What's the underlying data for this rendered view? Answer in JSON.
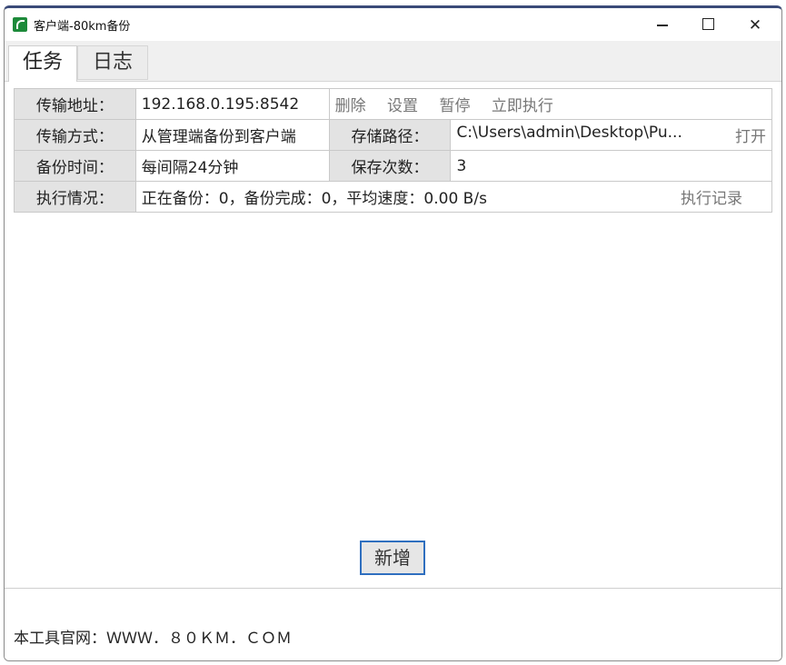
{
  "window": {
    "title": "客户端-80km备份",
    "controls": {
      "minimize": "—",
      "maximize": "□",
      "close": "✕"
    }
  },
  "tabs": [
    {
      "label": "任务",
      "active": true
    },
    {
      "label": "日志",
      "active": false
    }
  ],
  "task": {
    "address_label": "传输地址：",
    "address_value": "192.168.0.195:8542",
    "actions": {
      "delete": "删除",
      "settings": "设置",
      "pause": "暂停",
      "run_now": "立即执行"
    },
    "mode_label": "传输方式：",
    "mode_value": "从管理端备份到客户端",
    "path_label": "存储路径：",
    "path_value": "C:\\Users\\admin\\Desktop\\Pu...",
    "open_label": "打开",
    "time_label": "备份时间：",
    "time_value": "每间隔24分钟",
    "count_label": "保存次数：",
    "count_value": "3",
    "status_label": "执行情况：",
    "status_value": "正在备份：0，备份完成：0，平均速度：0.00 B/s",
    "history_label": "执行记录"
  },
  "add_button": "新增",
  "footer": {
    "text": "本工具官网：ＷＷＷ．８０ＫＭ．ＣＯＭ"
  },
  "colors": {
    "title_accent": "#3a4a78",
    "button_border": "#2f6fbf",
    "label_bg": "#e3e3e3",
    "icon_green": "#1d8a3a"
  }
}
